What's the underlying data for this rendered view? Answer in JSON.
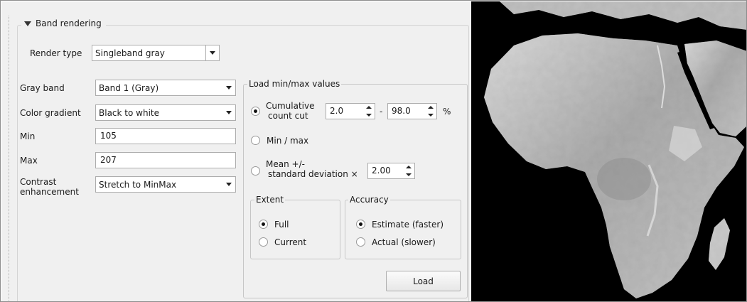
{
  "section": {
    "title": "Band rendering",
    "expanded": true
  },
  "render_type": {
    "label": "Render type",
    "value": "Singleband gray"
  },
  "gray_band": {
    "label": "Gray band",
    "value": "Band 1 (Gray)"
  },
  "color_gradient": {
    "label": "Color gradient",
    "value": "Black to white"
  },
  "min": {
    "label": "Min",
    "value": "105"
  },
  "max": {
    "label": "Max",
    "value": "207"
  },
  "contrast": {
    "label_line1": "Contrast",
    "label_line2": "enhancement",
    "value": "Stretch to MinMax"
  },
  "minmax": {
    "title": "Load min/max values",
    "cumulative": {
      "label_line1": "Cumulative",
      "label_line2": "count cut",
      "from": "2.0",
      "dash": "-",
      "to": "98.0",
      "unit": "%",
      "selected": true
    },
    "min_max": {
      "label": "Min / max",
      "selected": false
    },
    "mean_std": {
      "label_line1": "Mean +/-",
      "label_line2": "standard deviation ×",
      "value": "2.00",
      "selected": false
    },
    "extent": {
      "title": "Extent",
      "options": [
        "Full",
        "Current"
      ],
      "selected": "Full"
    },
    "accuracy": {
      "title": "Accuracy",
      "options": [
        "Estimate (faster)",
        "Actual (slower)"
      ],
      "selected": "Estimate (faster)"
    },
    "load_label": "Load"
  },
  "map": {
    "description_icon": "africa-dem-raster"
  }
}
